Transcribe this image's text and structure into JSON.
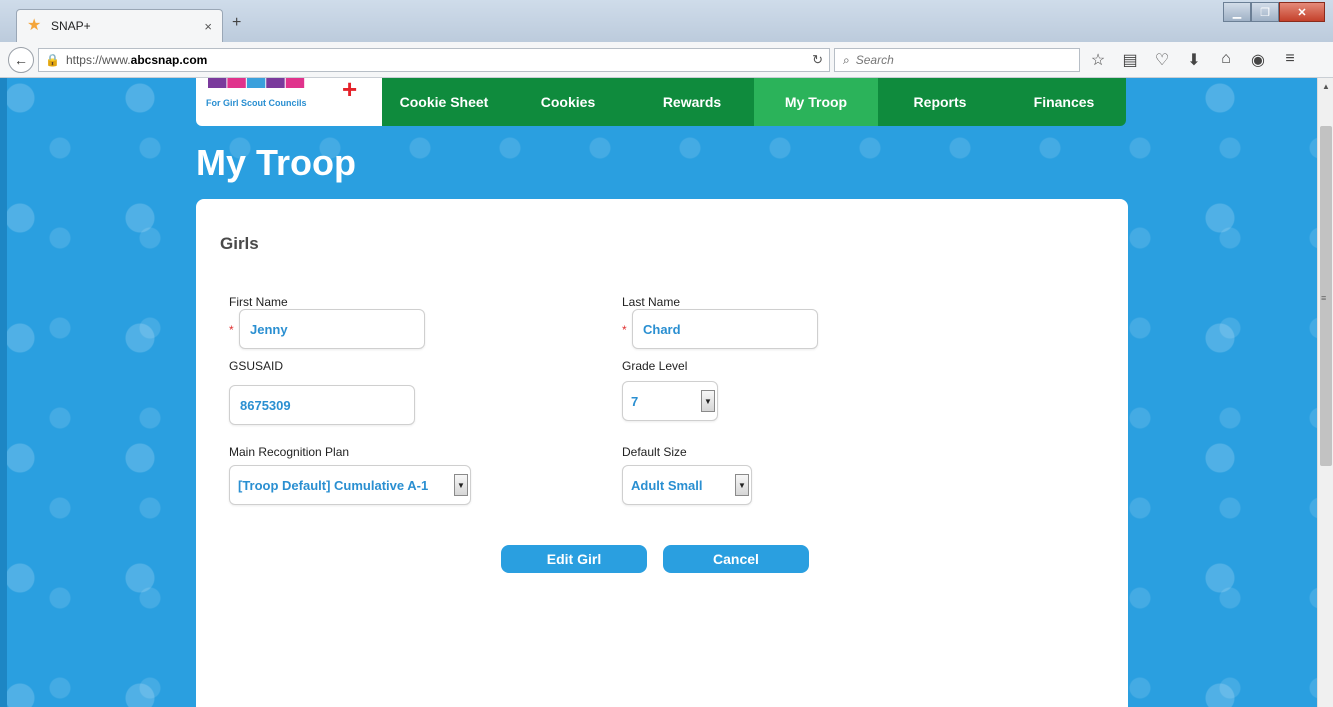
{
  "browser": {
    "tab_title": "SNAP+",
    "tab_close": "×",
    "new_tab": "+",
    "url_prefix": "https://www.",
    "url_domain": "abcsnap.com",
    "search_placeholder": "Search"
  },
  "site": {
    "logo_text": "For Girl Scout Councils",
    "nav": [
      {
        "label": "Cookie Sheet",
        "active": false
      },
      {
        "label": "Cookies",
        "active": false
      },
      {
        "label": "Rewards",
        "active": false
      },
      {
        "label": "My Troop",
        "active": true
      },
      {
        "label": "Reports",
        "active": false
      },
      {
        "label": "Finances",
        "active": false
      }
    ],
    "page_title": "My Troop"
  },
  "form": {
    "section_title": "Girls",
    "required_mark": "*",
    "first_name": {
      "label": "First Name",
      "value": "Jenny"
    },
    "last_name": {
      "label": "Last Name",
      "value": "Chard"
    },
    "gsusaid": {
      "label": "GSUSAID",
      "value": "8675309"
    },
    "grade_level": {
      "label": "Grade Level",
      "value": "7"
    },
    "recognition_plan": {
      "label": "Main Recognition Plan",
      "value": "[Troop Default] Cumulative A-1"
    },
    "default_size": {
      "label": "Default Size",
      "value": "Adult Small"
    },
    "edit_button": "Edit Girl",
    "cancel_button": "Cancel"
  },
  "colors": {
    "nav_green": "#0f8b3d",
    "nav_active": "#2bb35a",
    "page_blue": "#2a9fe0",
    "field_text": "#2a8fd1",
    "required_red": "#e03030"
  }
}
